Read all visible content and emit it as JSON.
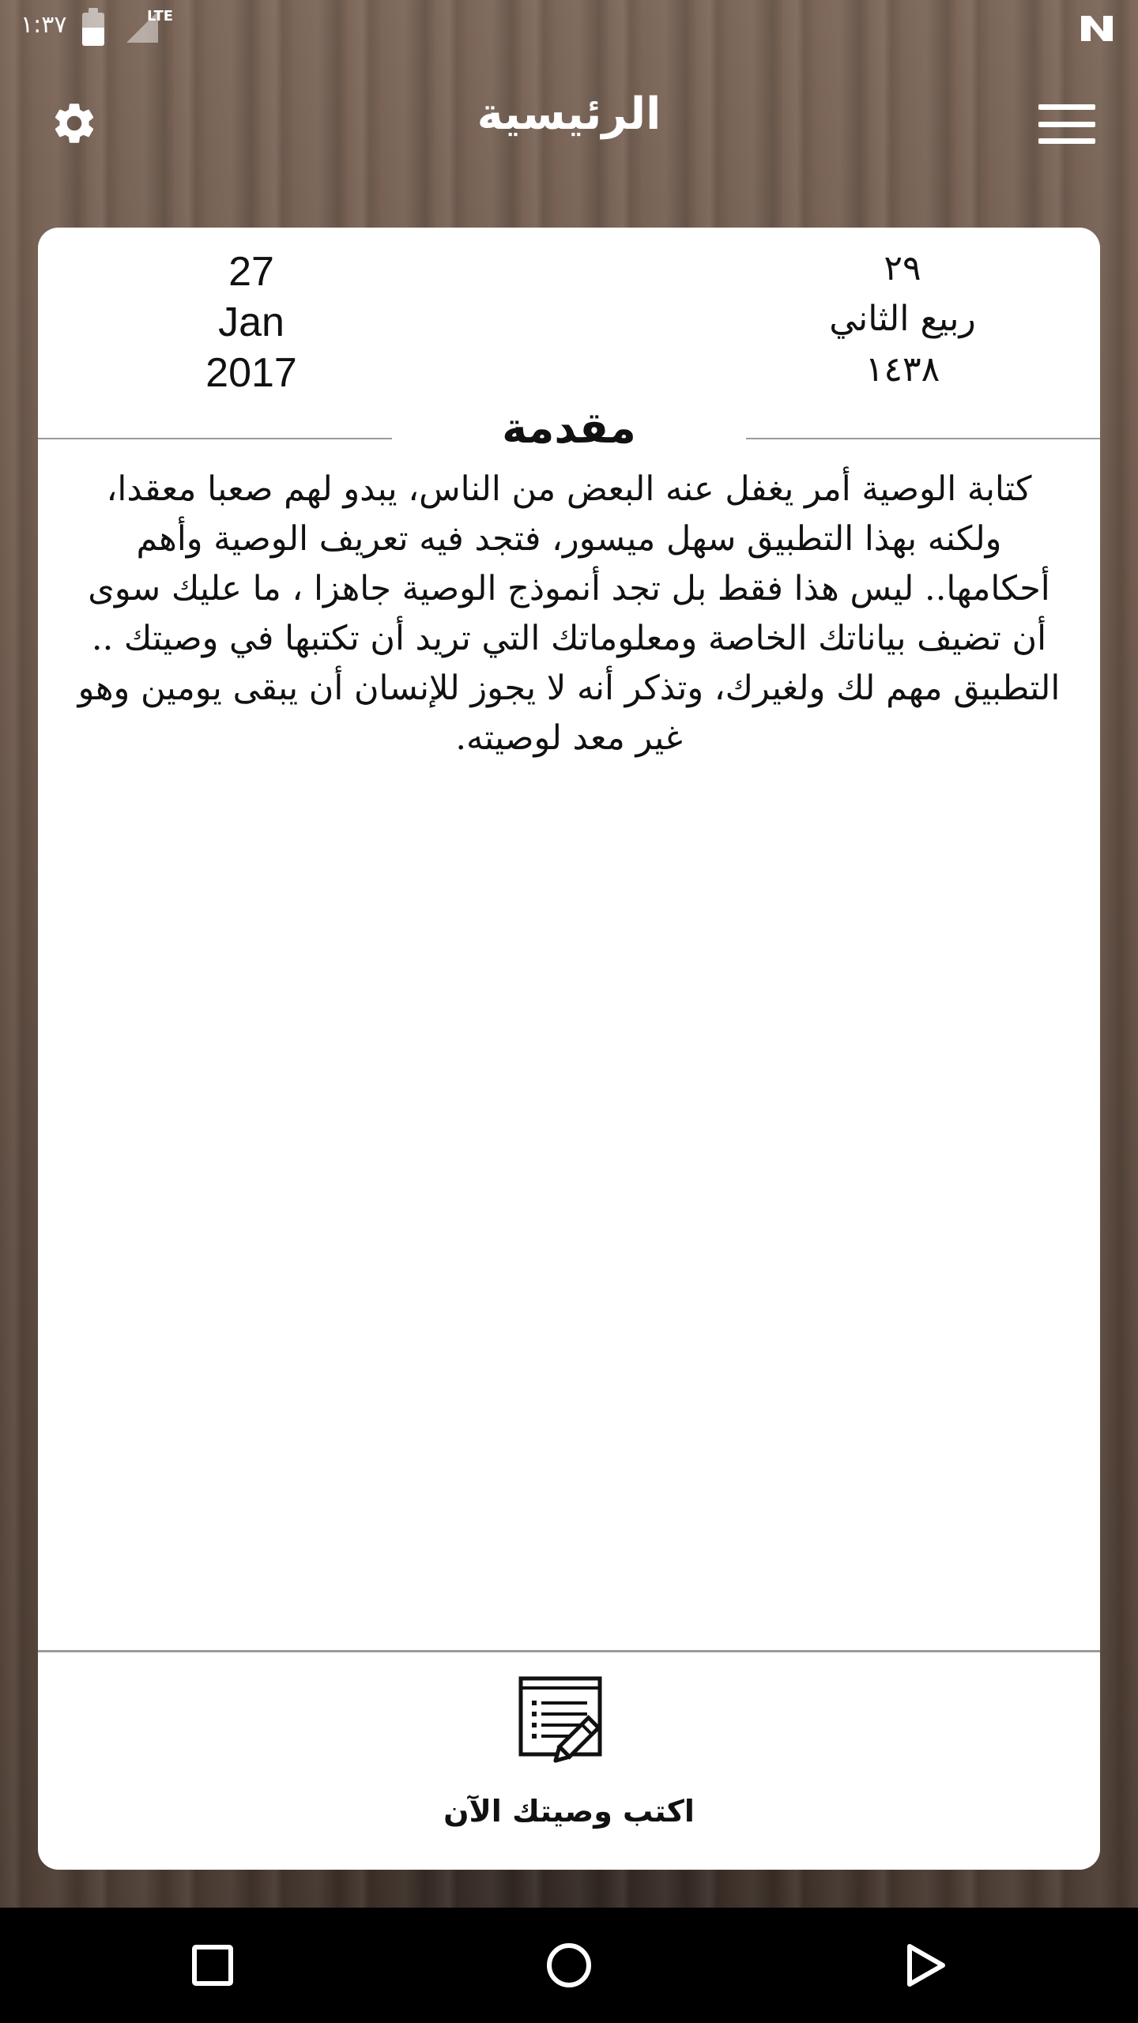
{
  "status_bar": {
    "time": "١:٣٧",
    "network": "LTE"
  },
  "header": {
    "title": "الرئيسية",
    "settings_icon": "gear-icon",
    "menu_icon": "hamburger-menu-icon"
  },
  "dates": {
    "gregorian": {
      "day": "27",
      "month": "Jan",
      "year": "2017"
    },
    "hijri": {
      "day": "٢٩",
      "month": "ربيع الثاني",
      "year": "١٤٣٨"
    }
  },
  "intro": {
    "title": "مقدمة",
    "paragraph_1": "كتابة الوصية أمر يغفل عنه البعض من الناس، يبدو لهم صعبا معقدا، ولكنه بهذا التطبيق سهل ميسور، فتجد فيه تعريف الوصية وأهم أحكامها.. ليس هذا فقط بل تجد أنموذج الوصية جاهزا ، ما عليك سوى أن تضيف بياناتك الخاصة ومعلوماتك التي تريد أن تكتبها في وصيتك ..",
    "paragraph_2": "التطبيق مهم لك ولغيرك، وتذكر أنه لا يجوز للإنسان أن يبقى يومين وهو غير معد لوصيته."
  },
  "action": {
    "label": "اكتب وصيتك الآن",
    "icon": "write-document-icon"
  },
  "nav": {
    "recent_icon": "square-recent-apps-icon",
    "home_icon": "circle-home-icon",
    "back_icon": "triangle-back-icon"
  },
  "colors": {
    "background": "#5a463a",
    "card": "#ffffff",
    "text": "#111111",
    "rule": "#9a9a9a"
  }
}
